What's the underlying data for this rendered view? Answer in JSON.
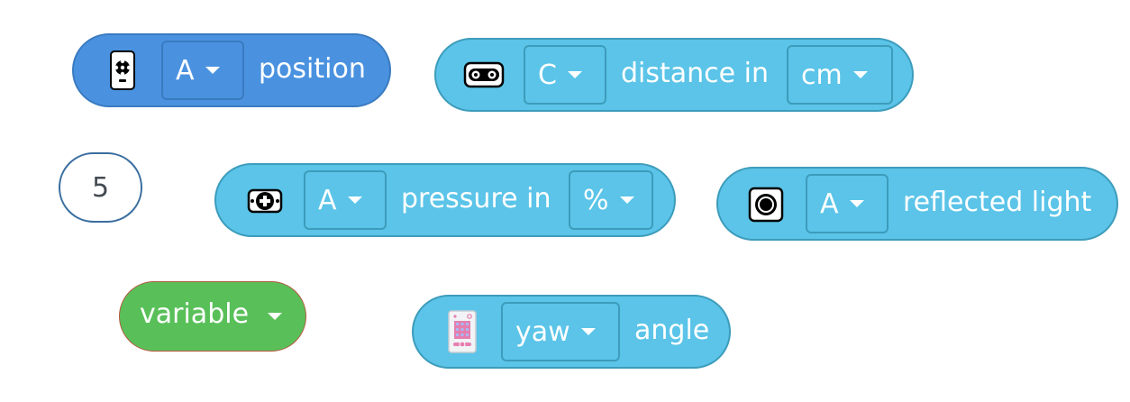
{
  "blocks": {
    "motor_position": {
      "port": "A",
      "label": "position"
    },
    "distance": {
      "port": "C",
      "label": "distance in",
      "unit": "cm"
    },
    "number_input": {
      "value": "5"
    },
    "pressure": {
      "port": "A",
      "label": "pressure in",
      "unit": "%"
    },
    "reflected_light": {
      "port": "A",
      "label": "reflected light"
    },
    "variable": {
      "label": "variable"
    },
    "yaw_angle": {
      "axis": "yaw",
      "label": "angle"
    }
  },
  "colors": {
    "motor_block": "#4a92e0",
    "sensor_block": "#5bc4e8",
    "variable_block": "#59c059",
    "number_outline": "#3a6ea0",
    "text_white": "#ffffff",
    "text_dark": "#444b53"
  },
  "icons": [
    "motor-icon",
    "distance-sensor-icon",
    "force-sensor-icon",
    "color-sensor-icon",
    "hub-icon",
    "dropdown-caret-icon"
  ]
}
